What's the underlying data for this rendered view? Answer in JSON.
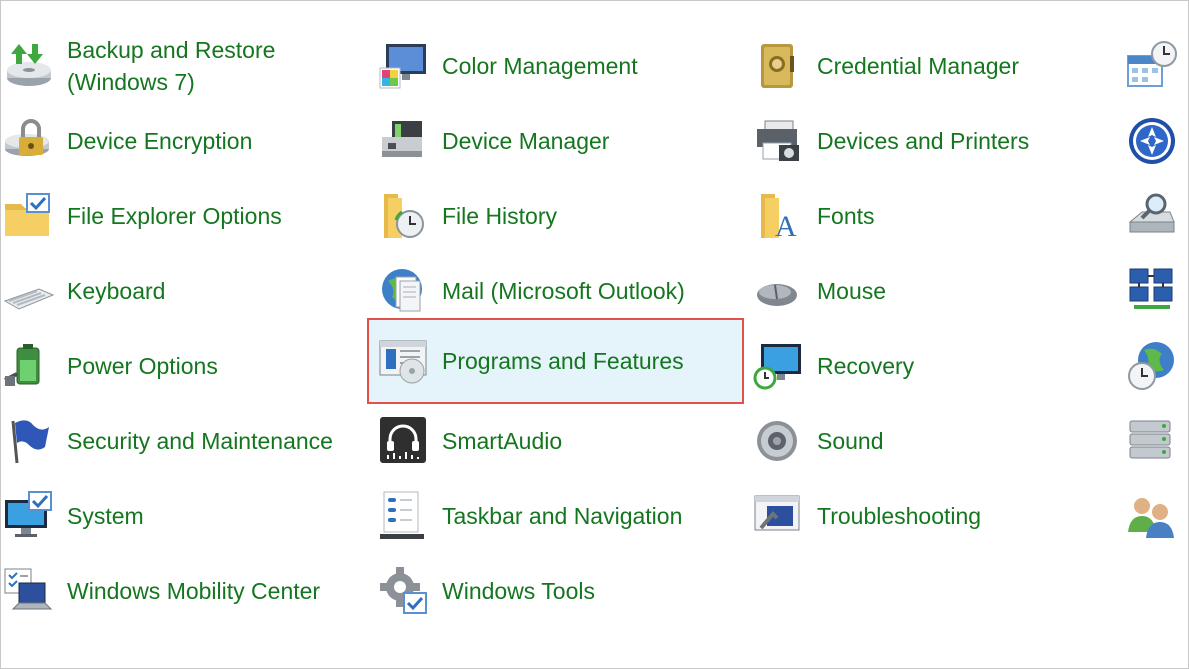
{
  "items": [
    {
      "label": "Backup and Restore (Windows 7)",
      "icon": "backup-restore-icon"
    },
    {
      "label": "Color Management",
      "icon": "color-management-icon"
    },
    {
      "label": "Credential Manager",
      "icon": "credential-manager-icon"
    },
    {
      "label": "",
      "icon": "date-time-icon"
    },
    {
      "label": "Device Encryption",
      "icon": "device-encryption-icon"
    },
    {
      "label": "Device Manager",
      "icon": "device-manager-icon"
    },
    {
      "label": "Devices and Printers",
      "icon": "devices-printers-icon"
    },
    {
      "label": "",
      "icon": "ease-of-access-icon"
    },
    {
      "label": "File Explorer Options",
      "icon": "file-explorer-options-icon"
    },
    {
      "label": "File History",
      "icon": "file-history-icon"
    },
    {
      "label": "Fonts",
      "icon": "fonts-icon"
    },
    {
      "label": "",
      "icon": "indexing-options-icon"
    },
    {
      "label": "Keyboard",
      "icon": "keyboard-icon"
    },
    {
      "label": "Mail (Microsoft Outlook)",
      "icon": "mail-icon"
    },
    {
      "label": "Mouse",
      "icon": "mouse-icon"
    },
    {
      "label": "",
      "icon": "network-sharing-icon"
    },
    {
      "label": "Power Options",
      "icon": "power-options-icon"
    },
    {
      "label": "Programs and Features",
      "icon": "programs-features-icon",
      "selected": true
    },
    {
      "label": "Recovery",
      "icon": "recovery-icon"
    },
    {
      "label": "",
      "icon": "region-icon"
    },
    {
      "label": "Security and Maintenance",
      "icon": "security-maintenance-icon"
    },
    {
      "label": "SmartAudio",
      "icon": "smartaudio-icon"
    },
    {
      "label": "Sound",
      "icon": "sound-icon"
    },
    {
      "label": "",
      "icon": "storage-spaces-icon"
    },
    {
      "label": "System",
      "icon": "system-icon"
    },
    {
      "label": "Taskbar and Navigation",
      "icon": "taskbar-navigation-icon"
    },
    {
      "label": "Troubleshooting",
      "icon": "troubleshooting-icon"
    },
    {
      "label": "",
      "icon": "user-accounts-icon"
    },
    {
      "label": "Windows Mobility Center",
      "icon": "windows-mobility-center-icon"
    },
    {
      "label": "Windows Tools",
      "icon": "windows-tools-icon"
    }
  ],
  "colors": {
    "label": "#14761e",
    "selected_bg": "#e5f3fb",
    "selected_border": "#e2504a"
  }
}
